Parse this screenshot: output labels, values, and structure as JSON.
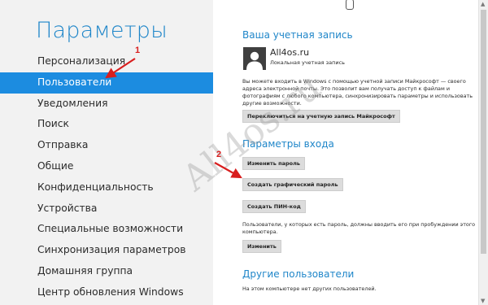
{
  "app": {
    "title": "Параметры"
  },
  "nav": {
    "items": [
      {
        "label": "Персонализация",
        "selected": false
      },
      {
        "label": "Пользователи",
        "selected": true
      },
      {
        "label": "Уведомления",
        "selected": false
      },
      {
        "label": "Поиск",
        "selected": false
      },
      {
        "label": "Отправка",
        "selected": false
      },
      {
        "label": "Общие",
        "selected": false
      },
      {
        "label": "Конфиденциальность",
        "selected": false
      },
      {
        "label": "Устройства",
        "selected": false
      },
      {
        "label": "Специальные возможности",
        "selected": false
      },
      {
        "label": "Синхронизация параметров",
        "selected": false
      },
      {
        "label": "Домашняя группа",
        "selected": false
      },
      {
        "label": "Центр обновления Windows",
        "selected": false
      }
    ]
  },
  "account": {
    "section_title": "Ваша учетная запись",
    "name": "All4os.ru",
    "type": "Локальная учетная запись",
    "description": "Вы можете входить в Windows с помощью учетной записи Майкрософт — своего адреса электронной почты. Это позволит вам получать доступ к файлам и фотографиям с любого компьютера, синхронизировать параметры и использовать другие возможности.",
    "switch_button": "Переключиться на учетную запись Майкрософт"
  },
  "signin": {
    "section_title": "Параметры входа",
    "change_password_button": "Изменить пароль",
    "picture_password_button": "Создать графический пароль",
    "pin_button": "Создать ПИН-код",
    "wake_text": "Пользователи, у которых есть пароль, должны вводить его при пробуждении этого компьютера.",
    "change_button": "Изменить"
  },
  "others": {
    "section_title": "Другие пользователи",
    "empty_text": "На этом компьютере нет других пользователей."
  },
  "annotations": {
    "marker1": "1",
    "marker2": "2",
    "watermark": "All4os.ru",
    "color": "#d81e1e"
  },
  "colors": {
    "accent": "#1f86c9",
    "selection": "#1c8ce0"
  }
}
